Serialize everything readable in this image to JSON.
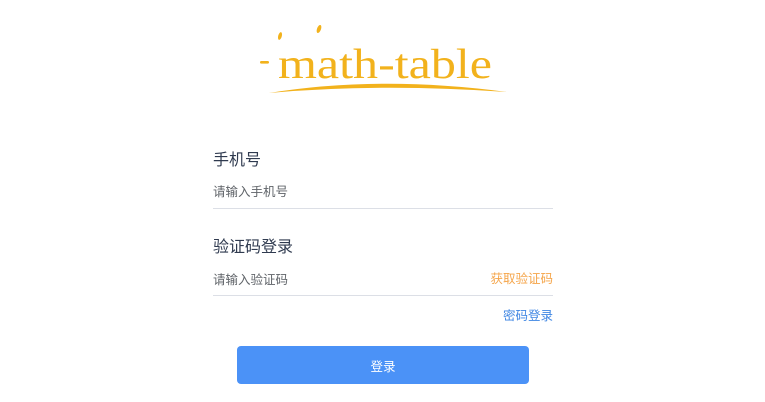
{
  "logo": {
    "text": "math-table",
    "color": "#f2b21c"
  },
  "form": {
    "phone": {
      "label": "手机号",
      "placeholder": "请输入手机号",
      "value": ""
    },
    "code": {
      "label": "验证码登录",
      "placeholder": "请输入验证码",
      "value": "",
      "get_code_label": "获取验证码"
    },
    "password_login_label": "密码登录",
    "submit_label": "登录"
  },
  "colors": {
    "accent": "#4b92f7",
    "link_blue": "#3f86e3",
    "link_orange": "#f5a54a",
    "label": "#2f3a4f",
    "logo_gold": "#f2b21c"
  }
}
